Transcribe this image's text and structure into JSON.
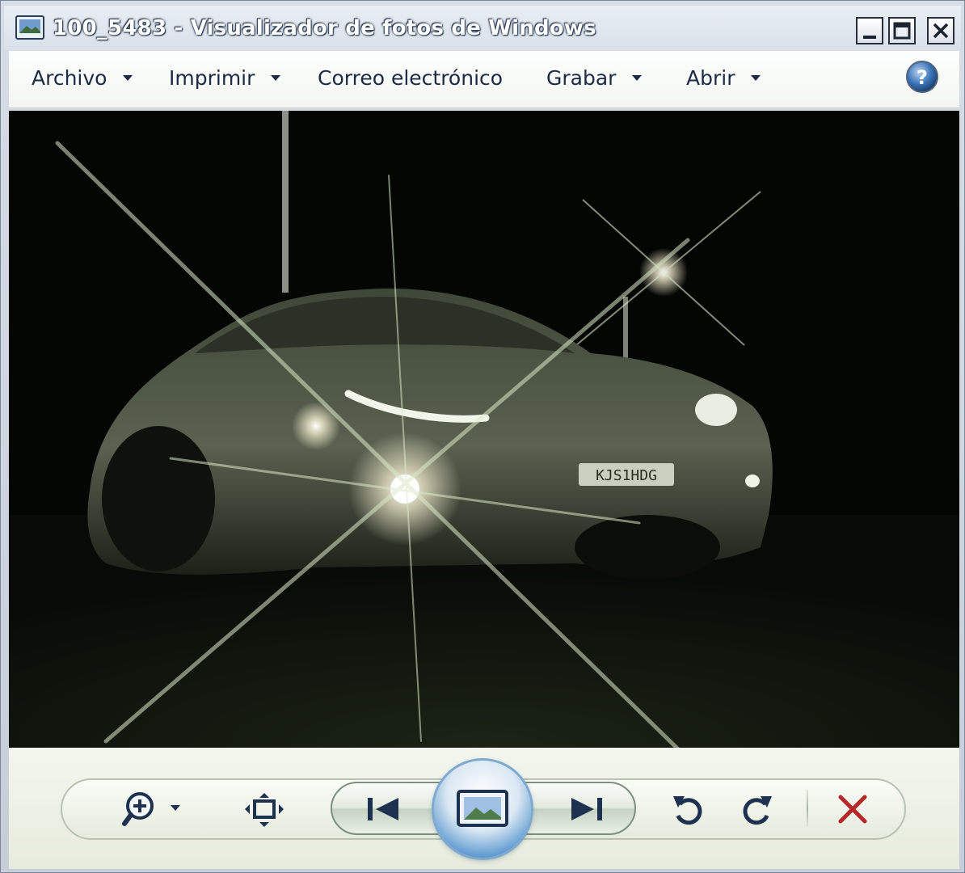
{
  "window": {
    "title": "100_5483 - Visualizador de fotos de Windows"
  },
  "menu": {
    "archivo": "Archivo",
    "imprimir": "Imprimir",
    "correo": "Correo electrónico",
    "grabar": "Grabar",
    "abrir": "Abrir"
  },
  "icons": {
    "app": "photo-viewer-icon",
    "help": "help-icon",
    "zoom": "zoom-icon",
    "fit": "actual-size-icon",
    "previous": "previous-icon",
    "slideshow": "slideshow-icon",
    "next": "next-icon",
    "rotate_ccw": "rotate-counterclockwise-icon",
    "rotate_cw": "rotate-clockwise-icon",
    "delete": "delete-icon"
  },
  "colors": {
    "delete": "#b8282a",
    "accent": "#2a6fb8",
    "menu_text": "#1c2a46"
  }
}
